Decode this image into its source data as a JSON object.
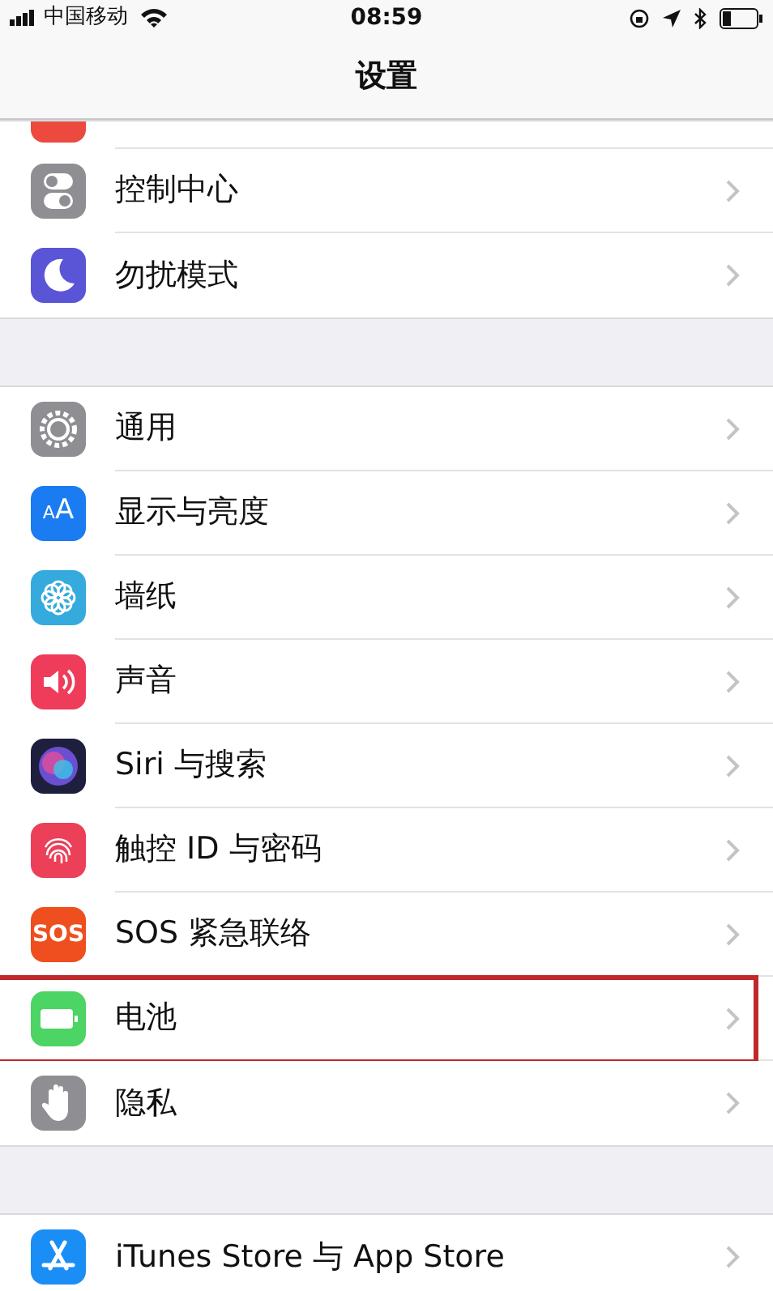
{
  "status_bar": {
    "carrier": "中国移动",
    "time": "08:59"
  },
  "nav": {
    "title": "设置"
  },
  "groups": [
    {
      "items": [
        {
          "color": "#ec4a3f",
          "highlighted": false
        },
        {
          "label": "控制中心",
          "color": "#8e8e93",
          "highlighted": false
        },
        {
          "label": "勿扰模式",
          "color": "#5a55d6",
          "highlighted": false
        }
      ]
    },
    {
      "items": [
        {
          "label": "通用",
          "color": "#8e8e93",
          "highlighted": false
        },
        {
          "label": "显示与亮度",
          "color": "#1a7cf0",
          "icon_text": "AA",
          "highlighted": false
        },
        {
          "label": "墙纸",
          "color": "#35aadc",
          "highlighted": false
        },
        {
          "label": "声音",
          "color": "#ee3c5a",
          "highlighted": false
        },
        {
          "label": "Siri 与搜索",
          "color": "#1e1f3d",
          "highlighted": false
        },
        {
          "label": "触控 ID 与密码",
          "color": "#ec3f58",
          "highlighted": false
        },
        {
          "label": "SOS 紧急联络",
          "color": "#ef4f1e",
          "icon_text": "SOS",
          "highlighted": false
        },
        {
          "label": "电池",
          "color": "#4cd464",
          "highlighted": true
        },
        {
          "label": "隐私",
          "color": "#8e8e93",
          "highlighted": false
        }
      ]
    },
    {
      "items": [
        {
          "label": "iTunes Store 与 App Store",
          "color": "#1b8ef5",
          "highlighted": false
        }
      ]
    }
  ]
}
